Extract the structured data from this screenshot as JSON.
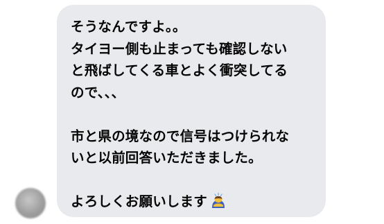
{
  "message": {
    "lines": [
      "そうなんですよ。。",
      "タイヨー側も止まっても確認しない",
      "と飛ばしてくる車とよく衝突してる",
      "ので、、、",
      "",
      "市と県の境なので信号はつけられな",
      "いと以前回答いただきました。",
      "",
      "よろしくお願いします"
    ],
    "trailing_emoji": "bowing-person-emoji"
  },
  "colors": {
    "bubble_background": "#e9eaed",
    "text": "#050505",
    "page_background": "#ffffff"
  }
}
